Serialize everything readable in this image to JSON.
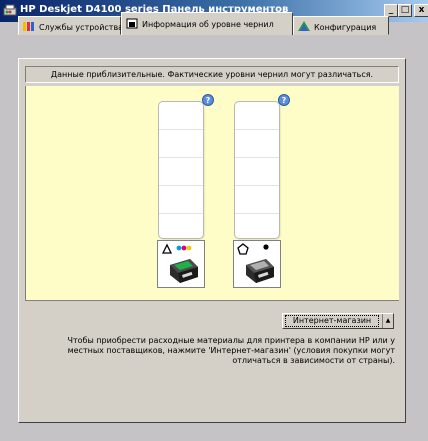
{
  "window": {
    "title": "HP Deskjet D4100 series Панель инструментов",
    "buttons": {
      "minimize": "_",
      "maximize": "□",
      "close": "x"
    }
  },
  "tabs": [
    {
      "label": "Службы устройства",
      "icon": "services-icon"
    },
    {
      "label": "Информация об уровне чернил",
      "icon": "ink-level-icon",
      "active": true
    },
    {
      "label": "Конфигурация",
      "icon": "configuration-icon"
    }
  ],
  "notice": "Данные приблизительные. Фактические уровни чернил могут различаться.",
  "cartridges": [
    {
      "type": "tri-color",
      "symbol": "triangle",
      "level": "?",
      "dot_colors": [
        "#00a0e0",
        "#e0007a",
        "#f0d000"
      ]
    },
    {
      "type": "black",
      "symbol": "pentagon",
      "level": "?",
      "dot_colors": [
        "#000000"
      ]
    }
  ],
  "store": {
    "button_label": "Интернет-магазин",
    "help_text": "Чтобы приобрести расходные материалы для принтера в компании HP или у местных поставщиков, нажмите 'Интернет-магазин' (условия покупки могут отличаться в зависимости от страны)."
  },
  "colors": {
    "title_gradient_start": "#0a246a",
    "ink_area_bg": "#fffdc7",
    "badge_blue": "#5b8ed6"
  }
}
